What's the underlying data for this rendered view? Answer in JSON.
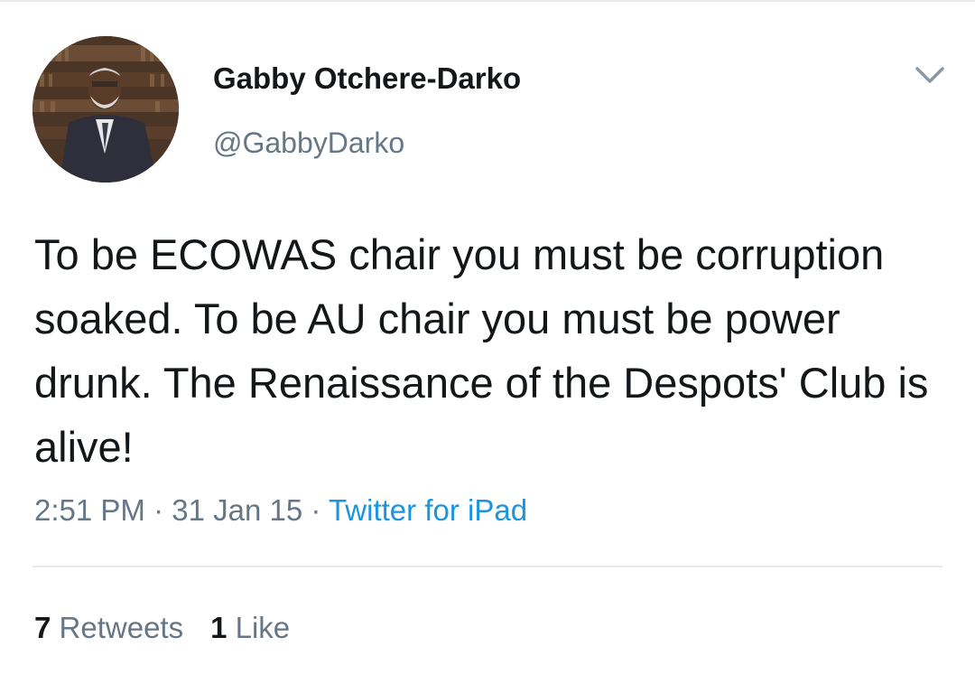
{
  "tweet": {
    "author": {
      "name": "Gabby Otchere-Darko",
      "handle": "@GabbyDarko",
      "avatar": "profile-photo"
    },
    "menu_icon": "chevron-down-icon",
    "text": "To be ECOWAS chair you must be corruption soaked. To be AU chair you must be power drunk. The Renaissance of the Despots' Club is alive!",
    "time": "2:51 PM",
    "date": "31 Jan 15",
    "separator": "·",
    "source": "Twitter for iPad",
    "stats": {
      "retweets_count": "7",
      "retweets_label": "Retweets",
      "likes_count": "1",
      "likes_label": "Like"
    }
  },
  "colors": {
    "text": "#14171a",
    "secondary": "#657786",
    "link": "#1b95e0",
    "divider": "#e6ecf0"
  }
}
